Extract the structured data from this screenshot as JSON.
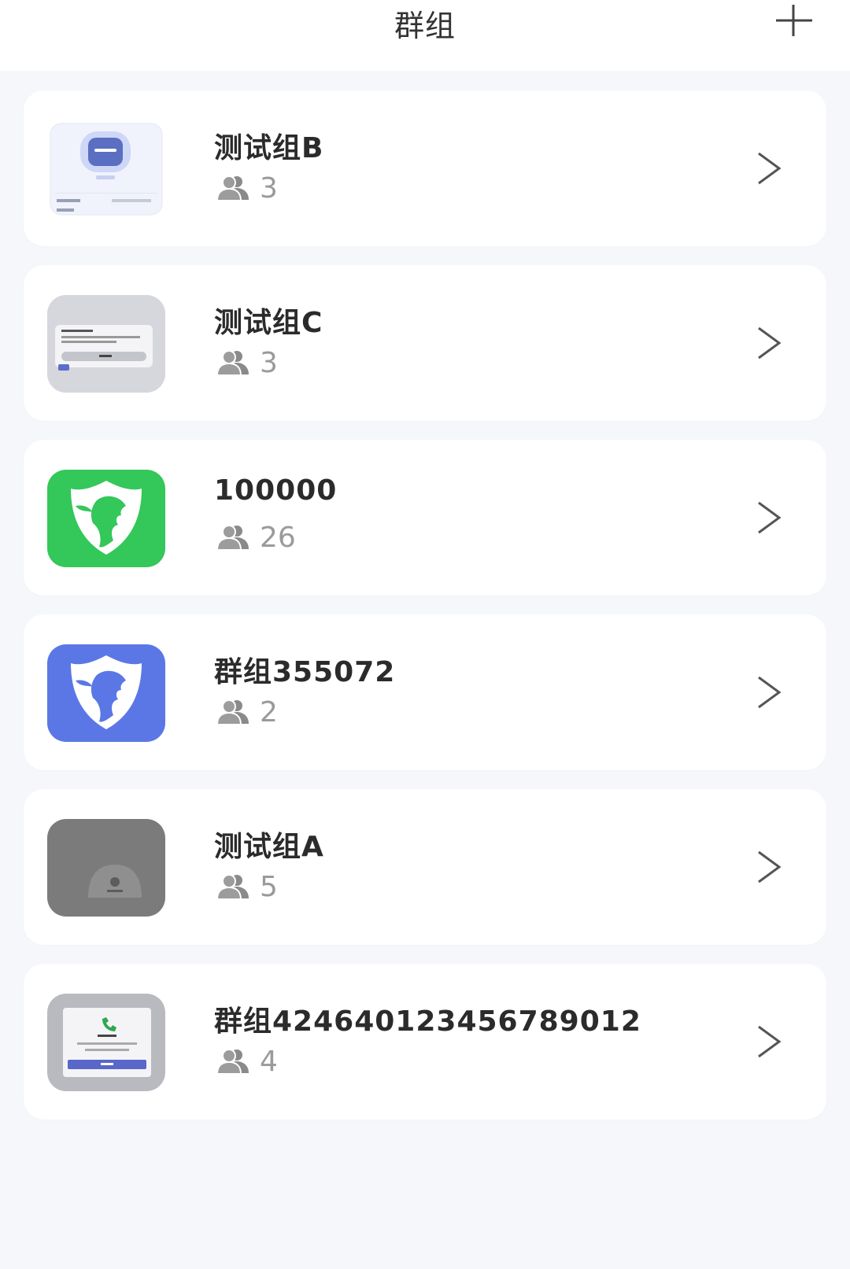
{
  "header": {
    "title": "群组"
  },
  "groups": [
    {
      "name": "测试组B",
      "members": "3",
      "thumb": "screenshot-device-icon"
    },
    {
      "name": "测试组C",
      "members": "3",
      "thumb": "screenshot-dialog-icon"
    },
    {
      "name": "100000",
      "members": "26",
      "thumb": "green-lion-shield-icon"
    },
    {
      "name": "群组355072",
      "members": "2",
      "thumb": "blue-lion-shield-icon"
    },
    {
      "name": "测试组A",
      "members": "5",
      "thumb": "gray-avatar-icon"
    },
    {
      "name": "群组42464012345678901​2",
      "members": "4",
      "thumb": "screenshot-call-icon"
    }
  ],
  "colors": {
    "background": "#f6f7fb",
    "card": "#ffffff",
    "green_brand": "#34c759",
    "blue_brand": "#5b77e6",
    "muted": "#9a9a9a"
  }
}
